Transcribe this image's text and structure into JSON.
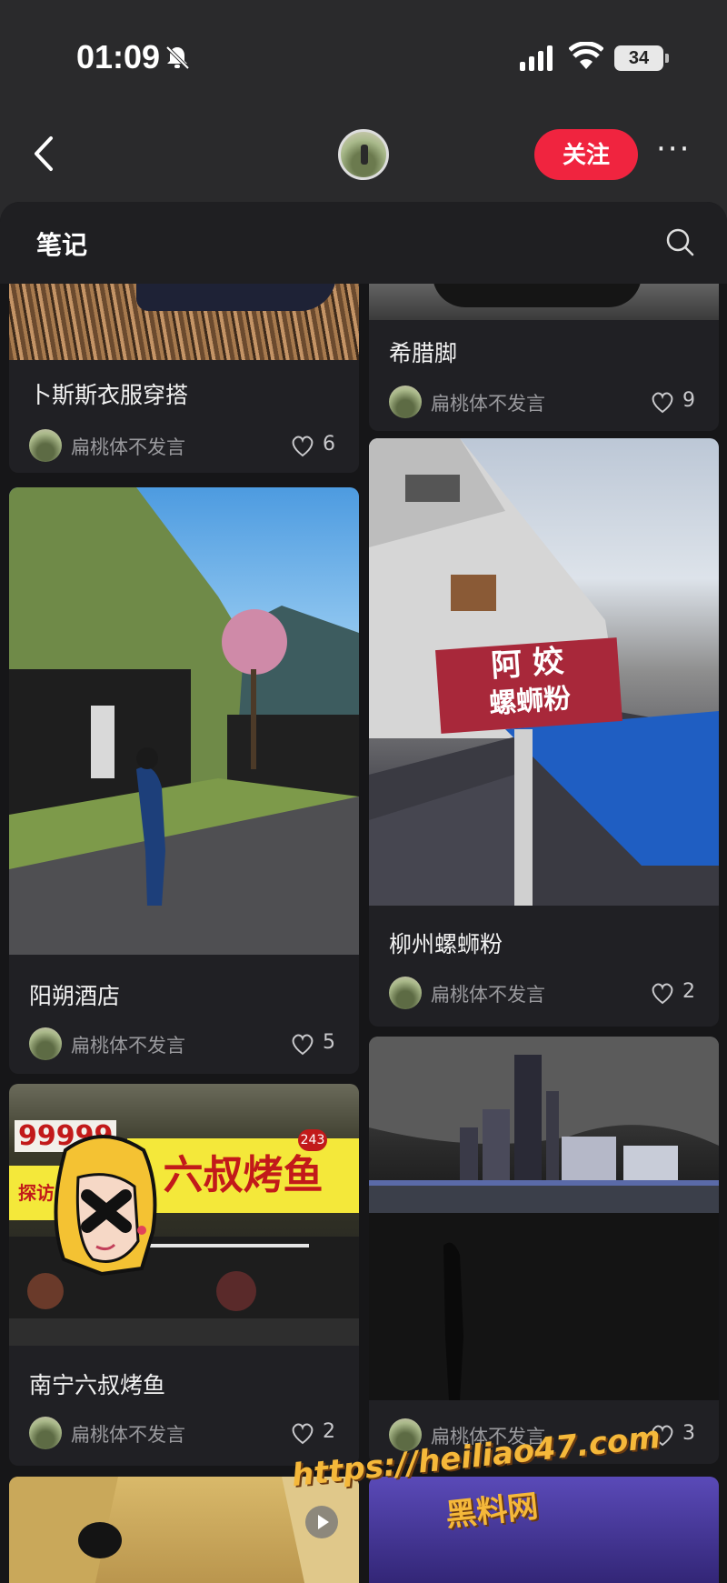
{
  "status_bar": {
    "time": "01:09",
    "battery": "34"
  },
  "header": {
    "follow_label": "关注",
    "more_label": "···"
  },
  "panel": {
    "title": "笔记"
  },
  "notes": [
    {
      "title": "卜斯斯衣服穿搭",
      "author": "扁桃体不发言",
      "likes": "6"
    },
    {
      "title": "希腊脚",
      "author": "扁桃体不发言",
      "likes": "9"
    },
    {
      "title": "阳朔酒店",
      "author": "扁桃体不发言",
      "likes": "5"
    },
    {
      "title": "柳州螺蛳粉",
      "author": "扁桃体不发言",
      "likes": "2",
      "sign_line1": "阿 姣",
      "sign_line2": "螺蛳粉"
    },
    {
      "title": "南宁六叔烤鱼",
      "author": "扁桃体不发言",
      "likes": "2",
      "sign_text": "六叔烤鱼",
      "sign_left": "探访",
      "sign_top": "99999",
      "sign_badge": "243"
    },
    {
      "author": "扁桃体不发言",
      "likes": "3"
    }
  ],
  "watermark": {
    "url": "https://heiliao47.com",
    "name": "黑料网"
  }
}
